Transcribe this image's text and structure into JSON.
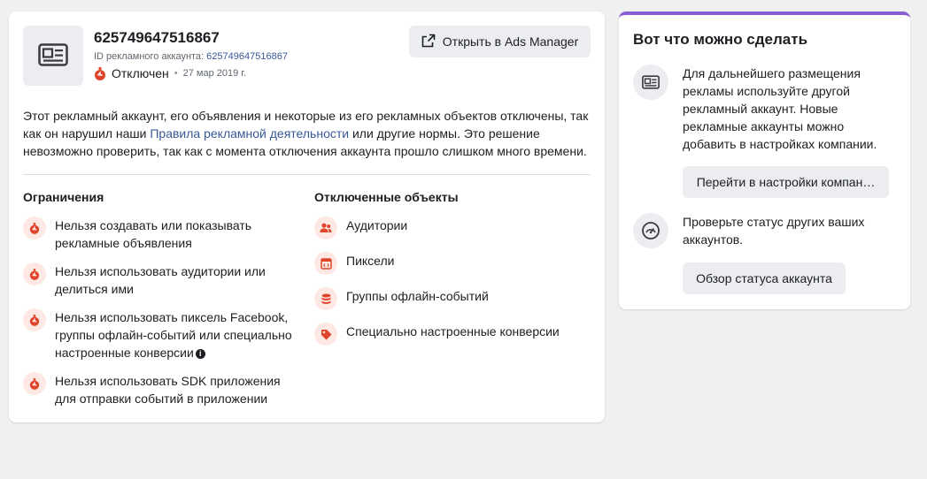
{
  "account": {
    "name": "625749647516867",
    "id_label": "ID рекламного аккаунта: ",
    "id_value": "625749647516867",
    "status": "Отключен",
    "separator": "•",
    "date": "27 мар 2019 г.",
    "open_button": "Открыть в Ads Manager",
    "icon": "ad-account-icon"
  },
  "description": {
    "part1": "Этот рекламный аккаунт, его объявления и некоторые из его рекламных объектов отключены, так как он нарушил наши ",
    "link": "Правила рекламной деятельности",
    "part2": " или другие нормы. Это решение невозможно проверить, так как с момента отключения аккаунта прошло слишком много времени."
  },
  "restrictions": {
    "title": "Ограничения",
    "items": [
      {
        "text": "Нельзя создавать или показывать рекламные объявления"
      },
      {
        "text": "Нельзя использовать аудитории или делиться ими"
      },
      {
        "text": "Нельзя использовать пиксель Facebook, группы офлайн-событий или специально настроенные конверсии"
      },
      {
        "text": "Нельзя использовать SDK приложения для отправки событий в приложении"
      }
    ],
    "icon": "restricted-icon",
    "info_icon": "info-icon"
  },
  "disabled_objects": {
    "title": "Отключенные объекты",
    "items": [
      {
        "text": "Аудитории",
        "icon": "audience-icon"
      },
      {
        "text": "Пиксели",
        "icon": "pixel-icon"
      },
      {
        "text": "Группы офлайн-событий",
        "icon": "offline-events-icon"
      },
      {
        "text": "Специально настроенные конверсии",
        "icon": "custom-conversion-icon"
      }
    ]
  },
  "side": {
    "title": "Вот что можно сделать",
    "actions": [
      {
        "text": "Для дальнейшего размещения рекламы используйте другой рекламный аккаунт. Новые рекламные аккаунты можно добавить в настройках компании.",
        "button": "Перейти в настройки компан…",
        "icon": "ad-account-icon"
      },
      {
        "text": "Проверьте статус других ваших аккаунтов.",
        "button": "Обзор статуса аккаунта",
        "icon": "gauge-icon"
      }
    ]
  },
  "colors": {
    "accent_purple": "#8a5cd6",
    "link_blue": "#385898",
    "alert_red": "#e0452b",
    "icon_bg_red": "#fde8e3"
  }
}
